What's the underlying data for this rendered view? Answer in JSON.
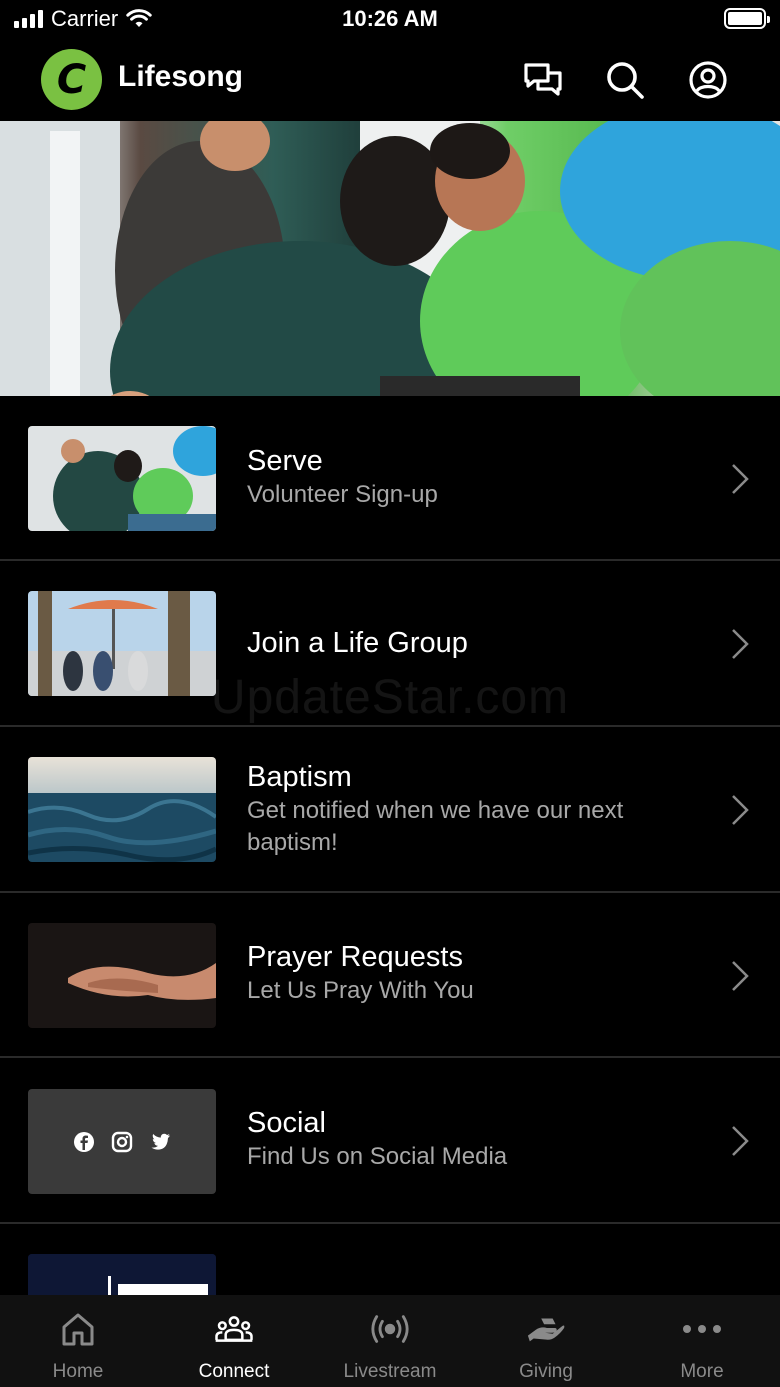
{
  "status_bar": {
    "carrier": "Carrier",
    "time": "10:26 AM"
  },
  "header": {
    "logo_letter": "C",
    "title": "Lifesong",
    "icons": [
      "chat-icon",
      "search-icon",
      "profile-icon"
    ]
  },
  "hero": {
    "image": "volunteers-at-check-in-table"
  },
  "list": [
    {
      "title": "Serve",
      "subtitle": "Volunteer Sign-up",
      "thumb": "serve-volunteers-photo"
    },
    {
      "title": "Join a Life Group",
      "subtitle": "",
      "thumb": "life-group-patio-photo"
    },
    {
      "title": "Baptism",
      "subtitle": "Get notified when we have our next baptism!",
      "thumb": "ocean-waves-photo"
    },
    {
      "title": "Prayer Requests",
      "subtitle": "Let Us Pray With You",
      "thumb": "open-hands-photo"
    },
    {
      "title": "Social",
      "subtitle": "Find Us on Social Media",
      "thumb": "social-icons-tile"
    }
  ],
  "watermark": "UpdateStar.com",
  "tabbar": {
    "tabs": [
      {
        "label": "Home",
        "icon": "home-icon"
      },
      {
        "label": "Connect",
        "icon": "people-icon",
        "active": true
      },
      {
        "label": "Livestream",
        "icon": "broadcast-icon"
      },
      {
        "label": "Giving",
        "icon": "giving-hand-icon"
      },
      {
        "label": "More",
        "icon": "more-dots-icon"
      }
    ]
  },
  "colors": {
    "brand_green": "#7ac142",
    "background": "#000000",
    "subtext": "#a8a8a8"
  }
}
